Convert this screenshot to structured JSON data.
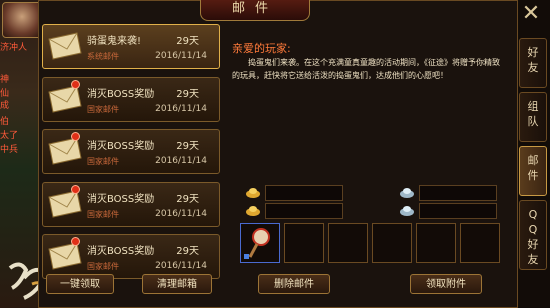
{
  "window": {
    "title": "邮件",
    "close_label": "✕"
  },
  "left_hud": {
    "lines": [
      "济冲人",
      "神",
      "仙",
      "成",
      "伯",
      "太了",
      "中兵"
    ]
  },
  "mail_list": [
    {
      "title": "骑蛋鬼来袭!",
      "days": "29天",
      "category": "系统邮件",
      "date": "2016/11/14",
      "selected": true,
      "unread": false
    },
    {
      "title": "消灭BOSS奖励",
      "days": "29天",
      "category": "国家邮件",
      "date": "2016/11/14",
      "selected": false,
      "unread": true
    },
    {
      "title": "消灭BOSS奖励",
      "days": "29天",
      "category": "国家邮件",
      "date": "2016/11/14",
      "selected": false,
      "unread": true
    },
    {
      "title": "消灭BOSS奖励",
      "days": "29天",
      "category": "国家邮件",
      "date": "2016/11/14",
      "selected": false,
      "unread": true
    },
    {
      "title": "消灭BOSS奖励",
      "days": "29天",
      "category": "国家邮件",
      "date": "2016/11/14",
      "selected": false,
      "unread": true
    }
  ],
  "buttons": {
    "collect_all": "一键领取",
    "clear_mail": "清理邮箱",
    "delete_mail": "删除邮件",
    "collect_attachment": "领取附件"
  },
  "detail": {
    "greeting": "亲爱的玩家:",
    "body": "捣蛋鬼们来袭。在这个充满童真童趣的活动期间，《征途》将赠予你精致的玩具，赶快将它送给活泼的捣蛋鬼们，达成他们的心愿吧！"
  },
  "side_tabs": [
    {
      "label": "好友",
      "chars": [
        "好",
        "友"
      ],
      "active": false
    },
    {
      "label": "组队",
      "chars": [
        "组",
        "队"
      ],
      "active": false
    },
    {
      "label": "邮件",
      "chars": [
        "邮",
        "件"
      ],
      "active": true
    },
    {
      "label": "QQ好友",
      "chars": [
        "Q",
        "Q",
        "好",
        "友"
      ],
      "active": false
    }
  ],
  "icons": {
    "gold": "gold-ingot-icon",
    "silver": "silver-ingot-icon",
    "attachment": "rattle-toy-icon"
  }
}
